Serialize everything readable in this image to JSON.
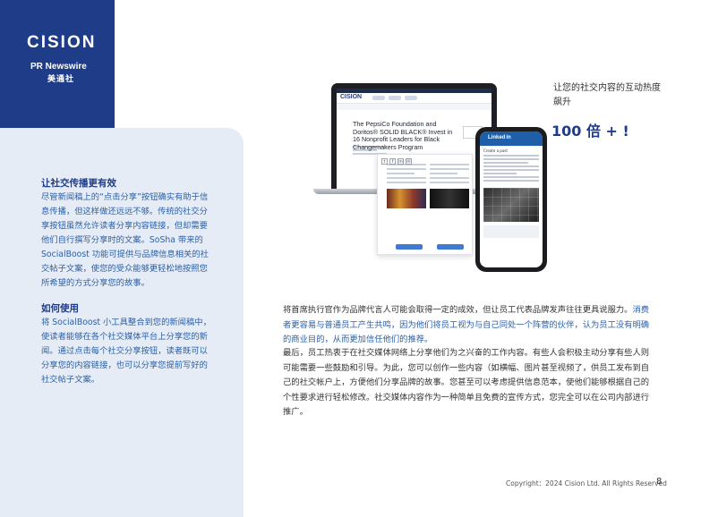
{
  "brand": {
    "cision_logo": "CISION",
    "prn_logo": "PR Newswire",
    "prn_cn": "美通社"
  },
  "side": {
    "h1": "让社交传播更有效",
    "p1": "尽管新闻稿上的“点击分享”按钮确实有助于信息传播，但这样做还远远不够。传统的社交分享按钮虽然允许读者分享内容链接，但却需要他们自行撰写分享时的文案。SoSha 带来的 SocialBoost 功能可提供与品牌信息相关的社交帖子文案，使您的受众能够更轻松地按照您所希望的方式分享您的故事。",
    "h2": "如何使用",
    "p2": "将 SocialBoost 小工具整合到您的新闻稿中，使读者能够在各个社交媒体平台上分享您的新闻。通过点击每个社交分享按钮，读者既可以分享您的内容链接，也可以分享您提前写好的社交帖子文案。"
  },
  "mockup": {
    "laptop_logo": "CISION",
    "laptop_headline": "The PepsiCo Foundation and Doritos® SOLID BLACK® Invest in 16 Nonprofit Leaders for Black Changemakers Program",
    "phone_app": "Linked",
    "phone_app_in": "in",
    "phone_post": "Create a post"
  },
  "callout": {
    "line1": "让您的社交内容的互动热度飙升",
    "line2": "100 倍 + !"
  },
  "body": {
    "p1_a": "将首席执行官作为品牌代言人可能会取得一定的成效，但让员工代表品牌发声往往更具说服力。",
    "p1_b": "消费者更容易与普通员工产生共鸣，因为他们将员工视为与自己同处一个阵营的伙伴，认为员工没有明确的商业目的，从而更加信任他们的推荐。",
    "p2": "最后，员工热衷于在社交媒体网络上分享他们为之兴奋的工作内容。有些人会积极主动分享有些人则可能需要一些鼓励和引导。为此，您可以创作一些内容（如横幅、图片甚至视频了，供员工发布到自己的社交帐户上，方便他们分享品牌的故事。您甚至可以考虑提供信息范本，使他们能够根据自己的个性要求进行轻松修改。社交媒体内容作为一种简单且免费的宣传方式，您完全可以在公司内部进行推广。"
  },
  "footer": {
    "copyright": "Copyright：2024 Cision Ltd. All Rights Reserved",
    "page": "8"
  },
  "colors": {
    "navy": "#1f3c88",
    "panel": "#e6ecf5",
    "accent_blue": "#2b5fa6",
    "logo_red": "#e8403b"
  }
}
